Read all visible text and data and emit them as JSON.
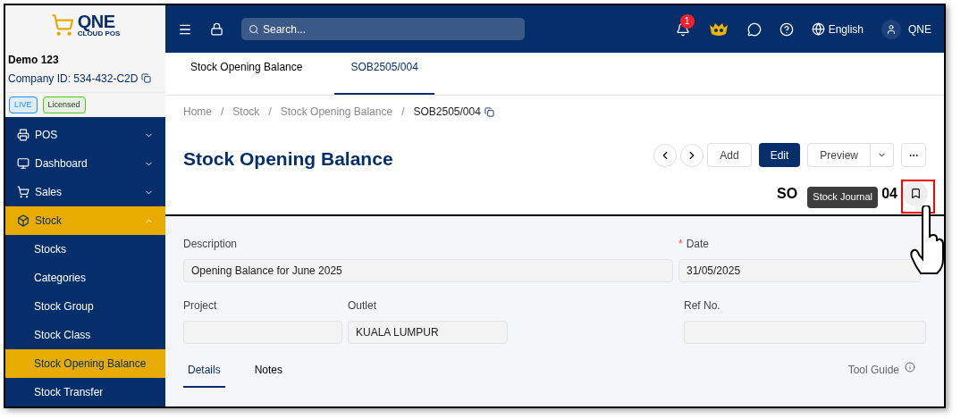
{
  "sidebar": {
    "logo": {
      "name": "QNE",
      "subtitle": "CLOUD POS"
    },
    "company": {
      "name": "Demo 123",
      "id": "Company ID: 534-432-C2D"
    },
    "badges": [
      {
        "label": "LIVE",
        "color": "#1890ff"
      },
      {
        "label": "Licensed",
        "color": "#52c41a"
      }
    ],
    "items": [
      {
        "label": "POS",
        "expanded": false,
        "selected": false
      },
      {
        "label": "Dashboard",
        "expanded": false,
        "selected": false
      },
      {
        "label": "Sales",
        "expanded": false,
        "selected": false
      },
      {
        "label": "Stock",
        "expanded": true,
        "selected": true,
        "children": [
          {
            "label": "Stocks",
            "selected": false
          },
          {
            "label": "Categories",
            "selected": false
          },
          {
            "label": "Stock Group",
            "selected": false
          },
          {
            "label": "Stock Class",
            "selected": false
          },
          {
            "label": "Stock Opening Balance",
            "selected": true
          },
          {
            "label": "Stock Transfer",
            "selected": false
          }
        ]
      }
    ]
  },
  "topbar": {
    "search": {
      "placeholder": "Search..."
    },
    "notifications": "1",
    "language": "English",
    "user": "QNE"
  },
  "tabs": [
    {
      "label": "Stock Opening Balance",
      "selected": false
    },
    {
      "label": "SOB2505/004",
      "selected": true
    }
  ],
  "breadcrumb": {
    "separator": "/",
    "items": [
      "Home",
      "Stock",
      "Stock Opening Balance",
      "SOB2505/004"
    ]
  },
  "page": {
    "title": "Stock Opening Balance",
    "doc_number_visible": [
      "SO",
      "04"
    ],
    "buttons": [
      {
        "label": "Add",
        "kind": "default"
      },
      {
        "label": "Edit",
        "kind": "primary"
      },
      {
        "label": "Preview",
        "kind": "split"
      }
    ],
    "tooltip": "Stock Journal"
  },
  "form": {
    "required_mark": "*",
    "fields": [
      {
        "label": "Description",
        "value": "Opening Balance for June 2025",
        "required": false
      },
      {
        "label": "Date",
        "value": "31/05/2025",
        "required": true
      },
      {
        "label": "Project",
        "required": false
      },
      {
        "label": "Outlet",
        "value": "KUALA LUMPUR",
        "required": false
      },
      {
        "label": "Ref No.",
        "required": false
      }
    ],
    "tabs": [
      {
        "label": "Details",
        "selected": true
      },
      {
        "label": "Notes",
        "selected": false
      }
    ],
    "tool_guide": "Tool Guide"
  }
}
